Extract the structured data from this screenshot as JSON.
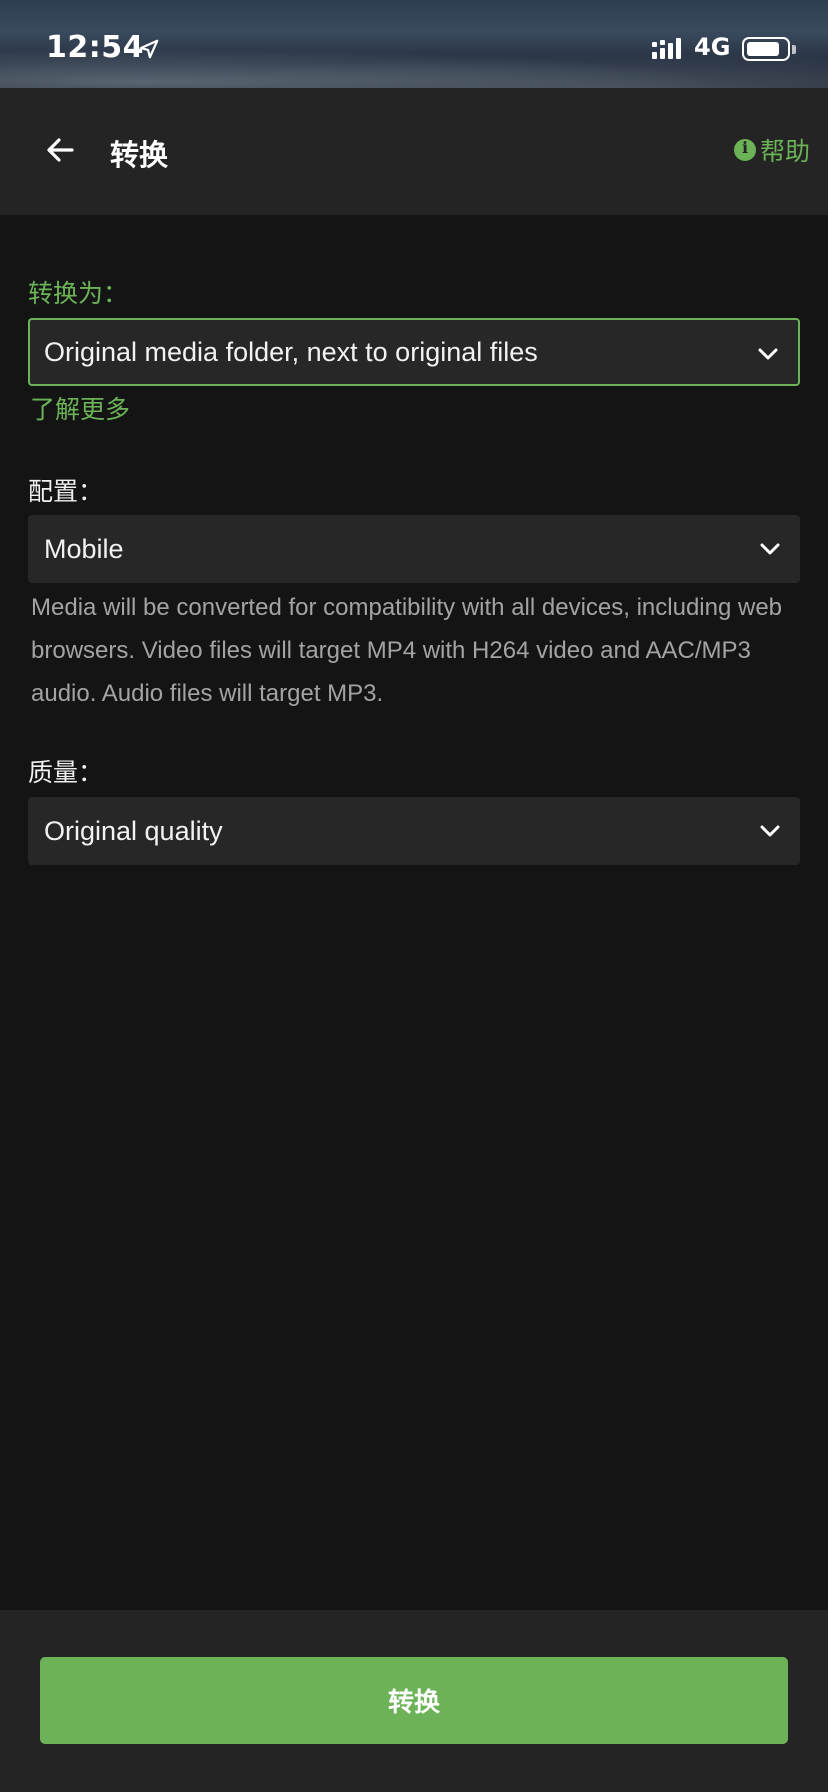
{
  "status_bar": {
    "time": "12:54",
    "network": "4G",
    "icons": [
      "location-arrow-icon",
      "signal-icon",
      "battery-icon"
    ]
  },
  "header": {
    "title": "转换",
    "help_label": "帮助",
    "back_icon": "arrow-left-icon",
    "help_icon": "info-icon"
  },
  "form": {
    "destination": {
      "label": "转换为：",
      "value": "Original media folder, next to original files",
      "learn_more": "了解更多"
    },
    "profile": {
      "label": "配置：",
      "value": "Mobile",
      "description": "Media will be converted for compatibility with all devices, including web browsers. Video files will target MP4 with H264 video and AAC/MP3 audio. Audio files will target MP3."
    },
    "quality": {
      "label": "质量：",
      "value": "Original quality"
    }
  },
  "footer": {
    "convert_label": "转换"
  },
  "colors": {
    "accent": "#6bb356",
    "background": "#141414",
    "surface": "#242424",
    "field": "#272727"
  }
}
